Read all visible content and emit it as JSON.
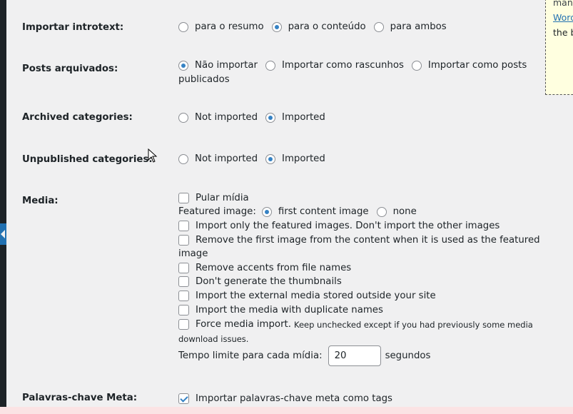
{
  "notice": {
    "line1": "many",
    "link": "Word",
    "line3": "the b"
  },
  "rows": {
    "introtext": {
      "label": "Importar introtext:",
      "options": [
        "para o resumo",
        "para o conteúdo",
        "para ambos"
      ],
      "selected": "para o conteúdo"
    },
    "archived_posts": {
      "label": "Posts arquivados:",
      "options": [
        "Não importar",
        "Importar como rascunhos",
        "Importar como posts"
      ],
      "wrap": "publicados",
      "selected": "Não importar"
    },
    "archived_categories": {
      "label": "Archived categories:",
      "options": [
        "Not imported",
        "Imported"
      ],
      "selected": "Imported"
    },
    "unpublished_categories": {
      "label": "Unpublished categories:",
      "options": [
        "Not imported",
        "Imported"
      ],
      "selected": "Imported"
    },
    "media": {
      "label": "Media:",
      "skip_media": "Pular mídia",
      "featured_label": "Featured image:",
      "featured_options": [
        "first content image",
        "none"
      ],
      "featured_selected": "first content image",
      "only_featured": "Import only the featured images. Don't import the other images",
      "remove_first_1": "Remove the first image from the content when it is used as the featured",
      "remove_first_2": "image",
      "remove_accents": "Remove accents from file names",
      "no_thumbnails": "Don't generate the thumbnails",
      "external_media": "Import the external media stored outside your site",
      "duplicate_names": "Import the media with duplicate names",
      "force_import": "Force media import.",
      "force_hint_1": "Keep unchecked except if you had previously some media",
      "force_hint_2": "download issues.",
      "timeout_label": "Tempo limite para cada mídia:",
      "timeout_value": "20",
      "timeout_unit": "segundos"
    },
    "meta_keywords": {
      "label": "Palavras-chave Meta:",
      "option": "Importar palavras-chave meta como tags",
      "checked": true
    }
  }
}
